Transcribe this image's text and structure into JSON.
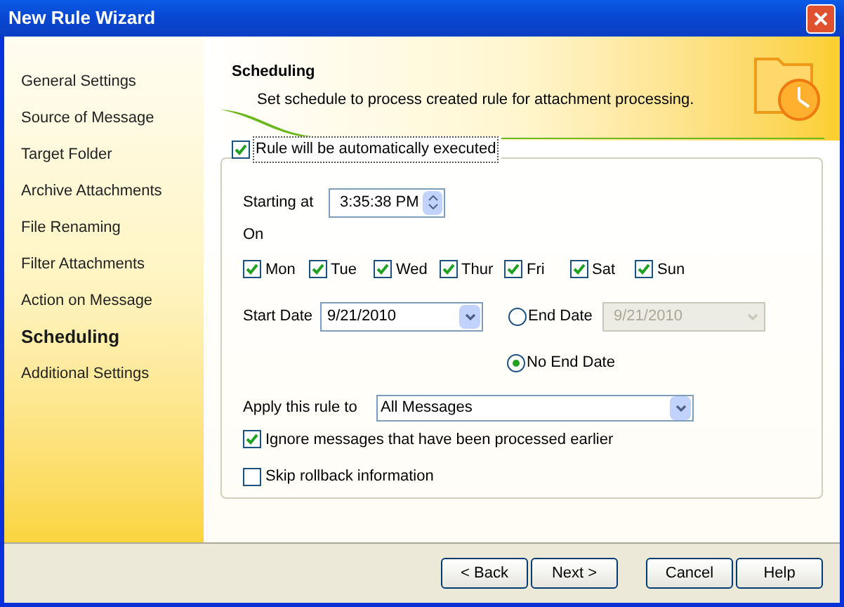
{
  "window": {
    "title": "New Rule Wizard"
  },
  "sidebar": {
    "items": [
      {
        "label": "General Settings",
        "selected": false
      },
      {
        "label": "Source of Message",
        "selected": false
      },
      {
        "label": "Target Folder",
        "selected": false
      },
      {
        "label": "Archive Attachments",
        "selected": false
      },
      {
        "label": "File Renaming",
        "selected": false
      },
      {
        "label": "Filter Attachments",
        "selected": false
      },
      {
        "label": "Action on Message",
        "selected": false
      },
      {
        "label": "Scheduling",
        "selected": true
      },
      {
        "label": "Additional Settings",
        "selected": false
      }
    ]
  },
  "header": {
    "title": "Scheduling",
    "subtitle": "Set schedule to process created rule for attachment processing."
  },
  "auto_execute": {
    "label": "Rule will be automatically executed",
    "checked": true
  },
  "starting_at": {
    "label": "Starting at",
    "value": "3:35:38 PM"
  },
  "on_label": "On",
  "days": [
    {
      "label": "Mon",
      "checked": true
    },
    {
      "label": "Tue",
      "checked": true
    },
    {
      "label": "Wed",
      "checked": true
    },
    {
      "label": "Thur",
      "checked": true
    },
    {
      "label": "Fri",
      "checked": true
    },
    {
      "label": "Sat",
      "checked": true
    },
    {
      "label": "Sun",
      "checked": true
    }
  ],
  "start_date": {
    "label": "Start Date",
    "value": "9/21/2010"
  },
  "end_options": [
    {
      "label": "End Date",
      "selected": false
    },
    {
      "label": "No End Date",
      "selected": true
    }
  ],
  "end_date": {
    "value": "9/21/2010",
    "disabled": true
  },
  "apply_to": {
    "label": "Apply this rule to",
    "value": "All Messages"
  },
  "options": [
    {
      "label": "Ignore messages that have been processed earlier",
      "checked": true
    },
    {
      "label": "Skip rollback information",
      "checked": false
    }
  ],
  "buttons": [
    "< Back",
    "Next >",
    "Cancel",
    "Help"
  ]
}
